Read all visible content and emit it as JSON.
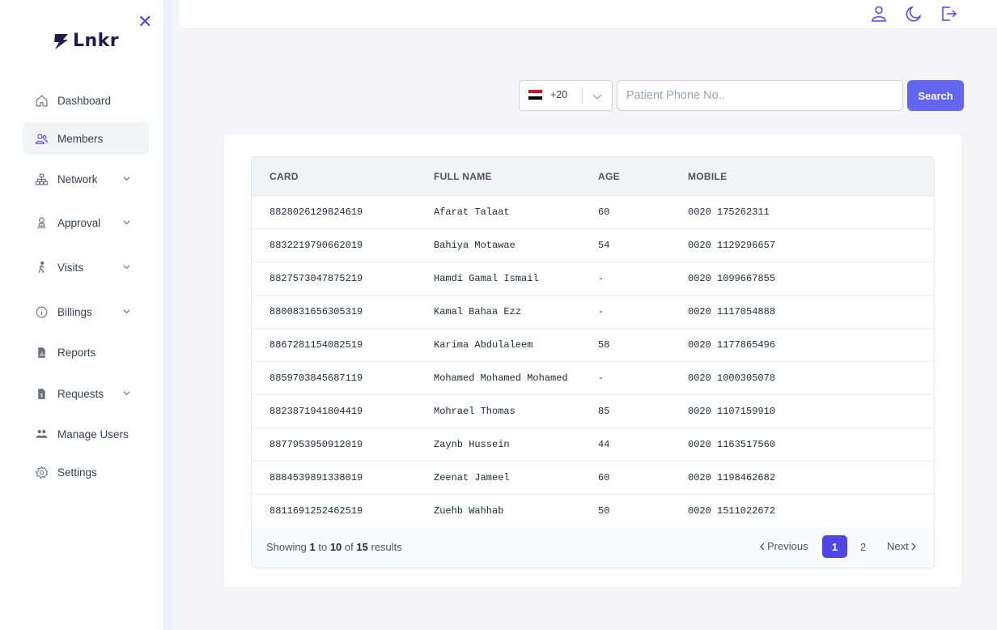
{
  "brand": {
    "name": "Lnkr"
  },
  "sidebar": {
    "items": [
      {
        "label": "Dashboard",
        "icon": "home-icon",
        "has_children": false,
        "active": false
      },
      {
        "label": "Members",
        "icon": "users-icon",
        "has_children": false,
        "active": true
      },
      {
        "label": "Network",
        "icon": "network-icon",
        "has_children": true,
        "active": false
      },
      {
        "label": "Approval",
        "icon": "approval-icon",
        "has_children": true,
        "active": false
      },
      {
        "label": "Visits",
        "icon": "walking-icon",
        "has_children": true,
        "active": false
      },
      {
        "label": "Billings",
        "icon": "info-circle-icon",
        "has_children": true,
        "active": false
      },
      {
        "label": "Reports",
        "icon": "report-icon",
        "has_children": false,
        "active": false
      },
      {
        "label": "Requests",
        "icon": "dollar-file-icon",
        "has_children": true,
        "active": false
      },
      {
        "label": "Manage Users",
        "icon": "group-icon",
        "has_children": false,
        "active": false
      },
      {
        "label": "Settings",
        "icon": "gear-icon",
        "has_children": false,
        "active": false
      }
    ]
  },
  "topbar": {
    "icons": [
      "user-icon",
      "moon-icon",
      "logout-icon"
    ]
  },
  "search": {
    "country_code": "+20",
    "flag": "egypt-flag",
    "phone_placeholder": "Patient Phone No..",
    "phone_value": "",
    "button_label": "Search"
  },
  "table": {
    "columns": [
      "CARD",
      "FULL NAME",
      "AGE",
      "MOBILE"
    ],
    "rows": [
      {
        "card": "8828026129824619",
        "name": "Afarat Talaat",
        "age": "60",
        "mobile": "0020 175262311"
      },
      {
        "card": "8832219790662019",
        "name": "Bahiya Motawae",
        "age": "54",
        "mobile": "0020 1129296657"
      },
      {
        "card": "8827573047875219",
        "name": "Hamdi Gamal Ismail",
        "age": "-",
        "mobile": "0020 1099667855"
      },
      {
        "card": "8800831656305319",
        "name": "Kamal Bahaa Ezz",
        "age": "-",
        "mobile": "0020 1117054888"
      },
      {
        "card": "8867281154082519",
        "name": "Karima Abdulaleem",
        "age": "58",
        "mobile": "0020 1177865496"
      },
      {
        "card": "8859703845687119",
        "name": "Mohamed Mohamed Mohamed",
        "age": "-",
        "mobile": "0020 1000305078"
      },
      {
        "card": "8823871941804419",
        "name": "Mohrael Thomas",
        "age": "85",
        "mobile": "0020 1107159910"
      },
      {
        "card": "8877953950912019",
        "name": "Zaynb Hussein",
        "age": "44",
        "mobile": "0020 1163517560"
      },
      {
        "card": "8884539891338019",
        "name": "Zeenat Jameel",
        "age": "60",
        "mobile": "0020 1198462682"
      },
      {
        "card": "8811691252462519",
        "name": "Zuehb Wahhab",
        "age": "50",
        "mobile": "0020 1511022672"
      }
    ]
  },
  "pagination": {
    "showing_prefix": "Showing",
    "from": "1",
    "to_word": "to",
    "to": "10",
    "of_word": "of",
    "total": "15",
    "results_word": "results",
    "previous_label": "Previous",
    "next_label": "Next",
    "pages": [
      "1",
      "2"
    ],
    "current_page": "1"
  },
  "colors": {
    "accent": "#4f46e5",
    "button": "#6366f1",
    "background": "#f5f5f7"
  }
}
